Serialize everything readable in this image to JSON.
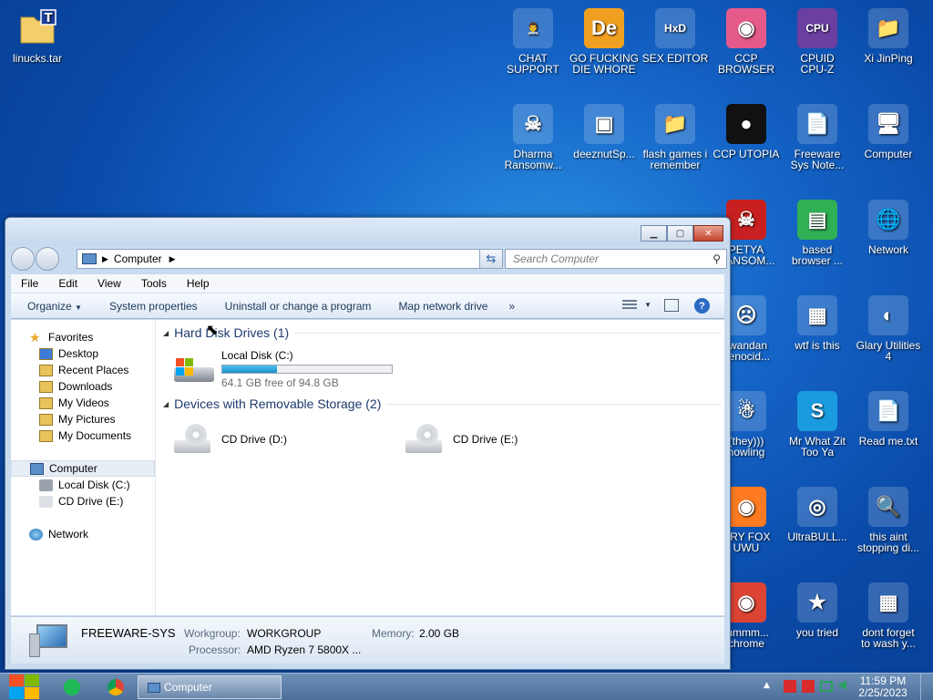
{
  "desktop": {
    "left_icon": {
      "label": "linucks.tar"
    },
    "icons": [
      {
        "label": "CHAT\nSUPPORT",
        "icon": "person-support-icon"
      },
      {
        "label": "GO FUCKING\nDIE WHORE",
        "icon": "de-logo-icon"
      },
      {
        "label": "SEX EDITOR",
        "icon": "hxd-icon"
      },
      {
        "label": "CCP\nBROWSER",
        "icon": "browser-icon"
      },
      {
        "label": "CPUID\nCPU-Z",
        "icon": "cpuz-icon"
      },
      {
        "label": "Xi JinPing",
        "icon": "user-folder-icon"
      },
      {
        "label": "Dharma\nRansomw...",
        "icon": "skull-icon"
      },
      {
        "label": "deeznutSp...",
        "icon": "stack-icon"
      },
      {
        "label": "flash games i\nremember",
        "icon": "folder-icon"
      },
      {
        "label": "CCP UTOPIA",
        "icon": "disc-icon"
      },
      {
        "label": "Freeware\nSys Note...",
        "icon": "document-icon"
      },
      {
        "label": "Computer",
        "icon": "computer-icon"
      },
      {
        "label": "PETYA\nRANSOM...",
        "icon": "skull-red-icon"
      },
      {
        "label": "based\nbrowser ...",
        "icon": "green-chat-icon"
      },
      {
        "label": "Network",
        "icon": "network-icon"
      },
      {
        "label": "rwandan\ngenocid...",
        "icon": "rage-face-icon"
      },
      {
        "label": "wtf is this",
        "icon": "calendar-doc-icon"
      },
      {
        "label": "Glary Utilities\n4",
        "icon": "glary-icon"
      },
      {
        "label": "(they)))\nhowling",
        "icon": "santa-icon"
      },
      {
        "label": "Mr What Zit\nToo Ya",
        "icon": "skype-icon"
      },
      {
        "label": "Read me.txt",
        "icon": "text-file-icon"
      },
      {
        "label": "RRY FOX\nUWU",
        "icon": "firefox-icon"
      },
      {
        "label": "UltraBULL...",
        "icon": "cd-icon"
      },
      {
        "label": "this aint\nstopping di...",
        "icon": "search-pc-icon"
      },
      {
        "label": "mmmm...\nchrome",
        "icon": "chrome-icon"
      },
      {
        "label": "you tried",
        "icon": "star-icon"
      },
      {
        "label": "dont forget\nto wash y...",
        "icon": "calendar-doc-icon"
      }
    ]
  },
  "window": {
    "address": {
      "crumb": "Computer"
    },
    "search_placeholder": "Search Computer",
    "menu": [
      "File",
      "Edit",
      "View",
      "Tools",
      "Help"
    ],
    "toolbar": {
      "organize": "Organize",
      "system_properties": "System properties",
      "uninstall": "Uninstall or change a program",
      "map_drive": "Map network drive",
      "more": "»"
    },
    "sidebar": {
      "favorites": "Favorites",
      "fav_items": [
        "Desktop",
        "Recent Places",
        "Downloads",
        "My Videos",
        "My Pictures",
        "My Documents"
      ],
      "computer": "Computer",
      "computer_items": [
        "Local Disk (C:)",
        "CD Drive (E:)"
      ],
      "network": "Network"
    },
    "groups": {
      "hdd": "Hard Disk Drives (1)",
      "removable": "Devices with Removable Storage (2)"
    },
    "local_disk": {
      "name": "Local Disk (C:)",
      "free": "64.1 GB free of 94.8 GB",
      "used_fraction": 0.324
    },
    "cd_drives": [
      "CD Drive (D:)",
      "CD Drive (E:)"
    ],
    "status": {
      "name": "FREEWARE-SYS",
      "workgroup_label": "Workgroup:",
      "workgroup": "WORKGROUP",
      "memory_label": "Memory:",
      "memory": "2.00 GB",
      "processor_label": "Processor:",
      "processor": "AMD Ryzen 7 5800X ..."
    }
  },
  "taskbar": {
    "active_task": "Computer",
    "time": "11:59 PM",
    "date": "2/25/2023"
  },
  "colors": {
    "accent": "#1565c8",
    "progress": "#26a0da"
  }
}
